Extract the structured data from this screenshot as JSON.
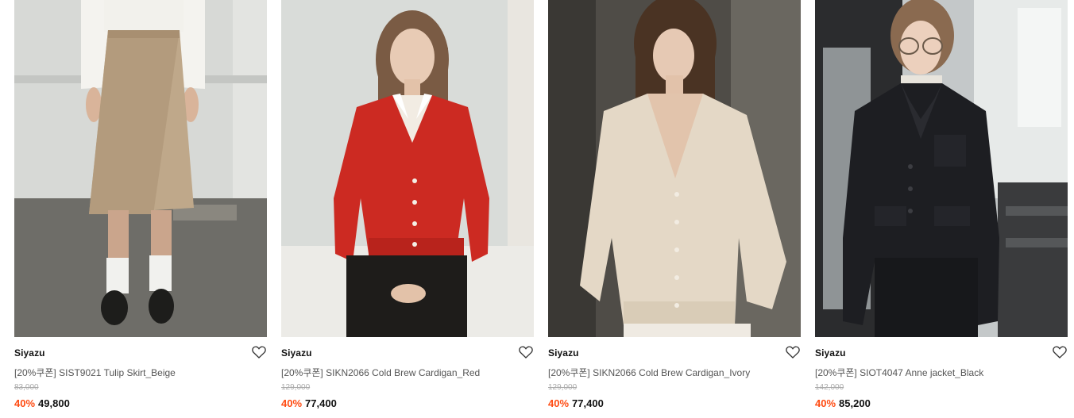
{
  "products": [
    {
      "brand": "Siyazu",
      "name": "[20%쿠폰] SIST9021 Tulip Skirt_Beige",
      "original_price": "83,000",
      "discount": "40%",
      "sale_price": "49,800",
      "wishlist_icon": "heart-outline-icon",
      "image_alt": "model wearing beige wrap skirt with white shirt",
      "colors": {
        "garment": "#bfa88a",
        "background": "#cfd1cf"
      }
    },
    {
      "brand": "Siyazu",
      "name": "[20%쿠폰] SIKN2066 Cold Brew Cardigan_Red",
      "original_price": "129,000",
      "discount": "40%",
      "sale_price": "77,400",
      "wishlist_icon": "heart-outline-icon",
      "image_alt": "model wearing red v-neck cardigan",
      "colors": {
        "garment": "#cc2a22",
        "background": "#dcdfdc"
      }
    },
    {
      "brand": "Siyazu",
      "name": "[20%쿠폰] SIKN2066 Cold Brew Cardigan_Ivory",
      "original_price": "129,000",
      "discount": "40%",
      "sale_price": "77,400",
      "wishlist_icon": "heart-outline-icon",
      "image_alt": "model wearing ivory v-neck cardigan",
      "colors": {
        "garment": "#e4d8c6",
        "background": "#55524c"
      }
    },
    {
      "brand": "Siyazu",
      "name": "[20%쿠폰] SIOT4047 Anne jacket_Black",
      "original_price": "142,000",
      "discount": "40%",
      "sale_price": "85,200",
      "wishlist_icon": "heart-outline-icon",
      "image_alt": "model wearing black tailored jacket with glasses",
      "colors": {
        "garment": "#1d1e22",
        "background": "#bfc3c4"
      }
    }
  ],
  "accent_color": "#ff4b12"
}
